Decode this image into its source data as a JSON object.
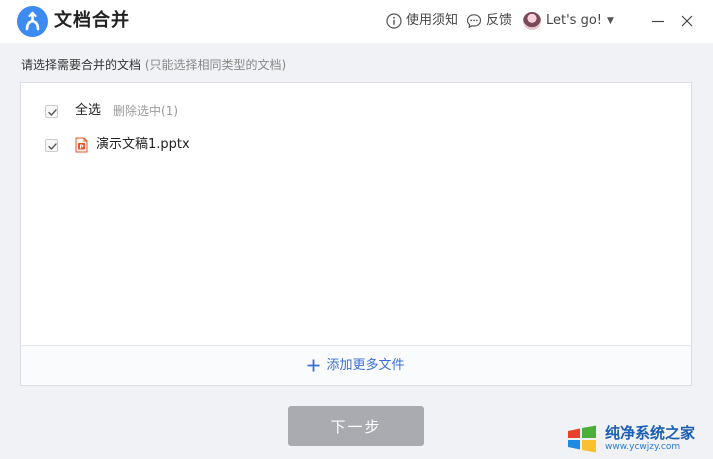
{
  "app": {
    "title": "文档合并"
  },
  "titlebar": {
    "help_label": "使用须知",
    "feedback_label": "反馈",
    "user_name": "Let's go!"
  },
  "instruction": {
    "text": "请选择需要合并的文档",
    "note": "(只能选择相同类型的文档)"
  },
  "list": {
    "select_all_label": "全选",
    "delete_selected_label": "删除选中(1)",
    "files": [
      {
        "name": "演示文稿1.pptx",
        "checked": true,
        "type": "pptx"
      }
    ]
  },
  "footer": {
    "add_more_label": "添加更多文件"
  },
  "next_button_label": "下一步",
  "watermark": {
    "title": "纯净系统之家",
    "url": "www.ycwjzy.com"
  },
  "colors": {
    "accent": "#3a6fd8",
    "logo": "#3d8bf2",
    "next_disabled": "#a9abb0",
    "pptx": "#e05a2b"
  },
  "icons": [
    "app-logo-icon",
    "info-icon",
    "chat-bubble-icon",
    "avatar",
    "caret-down-icon",
    "minimize-icon",
    "close-icon",
    "check-icon",
    "pptx-file-icon",
    "plus-icon"
  ]
}
